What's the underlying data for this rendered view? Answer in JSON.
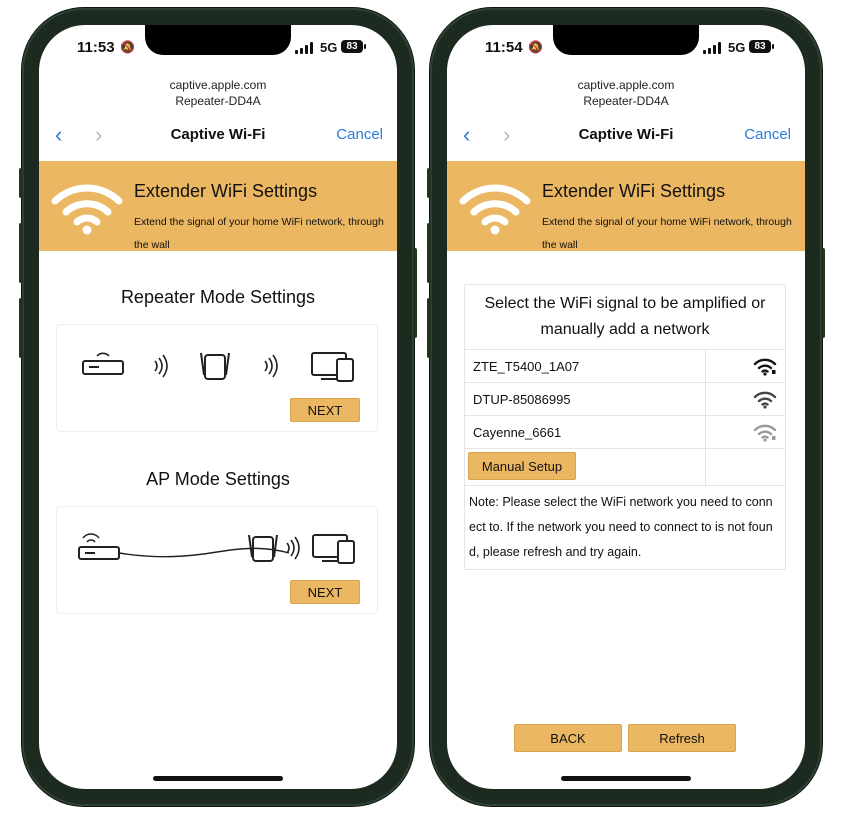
{
  "phones": [
    {
      "status": {
        "time": "11:53",
        "network": "5G",
        "battery": "83"
      },
      "url": {
        "host": "captive.apple.com",
        "ssid": "Repeater-DD4A"
      },
      "nav": {
        "title": "Captive Wi-Fi",
        "cancel": "Cancel"
      },
      "banner": {
        "title": "Extender WiFi Settings",
        "subtitle": "Extend the signal of your home WiFi network, through the wall"
      },
      "repeater": {
        "title": "Repeater Mode Settings",
        "next": "NEXT"
      },
      "ap": {
        "title": "AP Mode Settings",
        "next": "NEXT"
      }
    },
    {
      "status": {
        "time": "11:54",
        "network": "5G",
        "battery": "83"
      },
      "url": {
        "host": "captive.apple.com",
        "ssid": "Repeater-DD4A"
      },
      "nav": {
        "title": "Captive Wi-Fi",
        "cancel": "Cancel"
      },
      "banner": {
        "title": "Extender WiFi Settings",
        "subtitle": "Extend the signal of your home WiFi network, through the wall"
      },
      "select_heading": "Select the WiFi signal to be amplified or manually add a network",
      "networks": [
        {
          "ssid": "ZTE_T5400_1A07",
          "signal": "strong"
        },
        {
          "ssid": "DTUP-85086995",
          "signal": "medium"
        },
        {
          "ssid": "Cayenne_6661",
          "signal": "weak"
        }
      ],
      "manual_setup": "Manual Setup",
      "note": "Note: Please select the WiFi network you need to connect to. If the network you need to connect to is not found, please refresh and try again.",
      "back": "BACK",
      "refresh": "Refresh"
    }
  ],
  "colors": {
    "accent": "#ecb762",
    "link": "#2a7dd8",
    "frame": "#1c2a1f"
  },
  "icons": [
    "bell-slash-icon",
    "cellular-signal-icon",
    "battery-icon",
    "chevron-left-icon",
    "chevron-right-icon",
    "wifi-icon",
    "router-icon",
    "repeater-icon",
    "devices-icon",
    "wave-icon"
  ]
}
